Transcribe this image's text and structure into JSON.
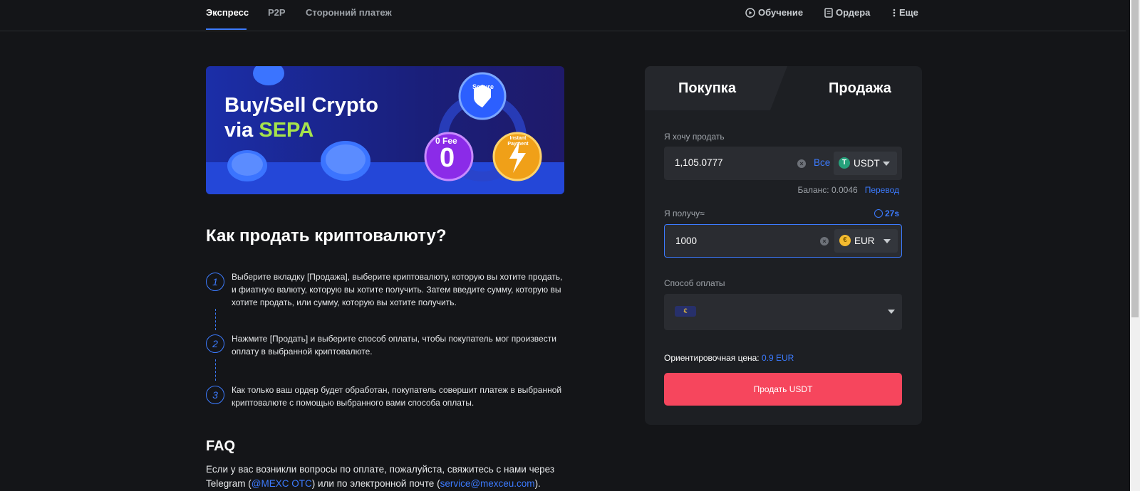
{
  "nav": {
    "tabs": [
      "Экспресс",
      "P2P",
      "Сторонний платеж"
    ],
    "tutorial": "Обучение",
    "orders": "Ордера",
    "more": "Еще"
  },
  "banner": {
    "line1": "Buy/Sell Crypto",
    "line2_prefix": "via ",
    "line2_accent": "SEPA",
    "badges": [
      "Secure",
      "0 Fee",
      "0",
      "Instant Payment"
    ]
  },
  "guide": {
    "title": "Как продать криптовалюту?",
    "steps": [
      {
        "num": "1",
        "text": "Выберите вкладку [Продажа], выберите криптовалюту, которую вы хотите продать, и фиатную валюту, которую вы хотите получить. Затем введите сумму, которую вы хотите продать, или сумму, которую вы хотите получить."
      },
      {
        "num": "2",
        "text": "Нажмите [Продать] и выберите способ оплаты, чтобы покупатель мог произвести оплату в выбранной криптовалюте."
      },
      {
        "num": "3",
        "text": "Как только ваш ордер будет обработан, покупатель совершит платеж в выбранной криптовалюте с помощью выбранного вами способа оплаты."
      }
    ]
  },
  "faq": {
    "title": "FAQ",
    "text_a": "Если у вас возникли вопросы по оплате, пожалуйста, свяжитесь с нами через Telegram (",
    "telegram": "@MEXC OTC",
    "text_b": ") или по электронной почте (",
    "email": "service@mexceu.com",
    "text_c": ")."
  },
  "panel": {
    "tab_buy": "Покупка",
    "tab_sell": "Продажа",
    "sell_label": "Я хочу продать",
    "sell_amount": "1,105.0777",
    "all_link": "Все",
    "sell_currency": "USDT",
    "balance": "Баланс: 0.0046",
    "transfer": "Перевод",
    "receive_label": "Я получу≈",
    "timer": "27s",
    "receive_amount": "1000",
    "receive_currency": "EUR",
    "payment_label": "Способ оплаты",
    "payment_badge": "€",
    "price_label": "Ориентировочная цена: ",
    "price_value": "0.9 EUR",
    "sell_button": "Продать USDT"
  },
  "colors": {
    "accent": "#3c7bff",
    "sell_red": "#f6465d",
    "usdt_green": "#26a17b",
    "eur_gold": "#f3ba2f"
  }
}
